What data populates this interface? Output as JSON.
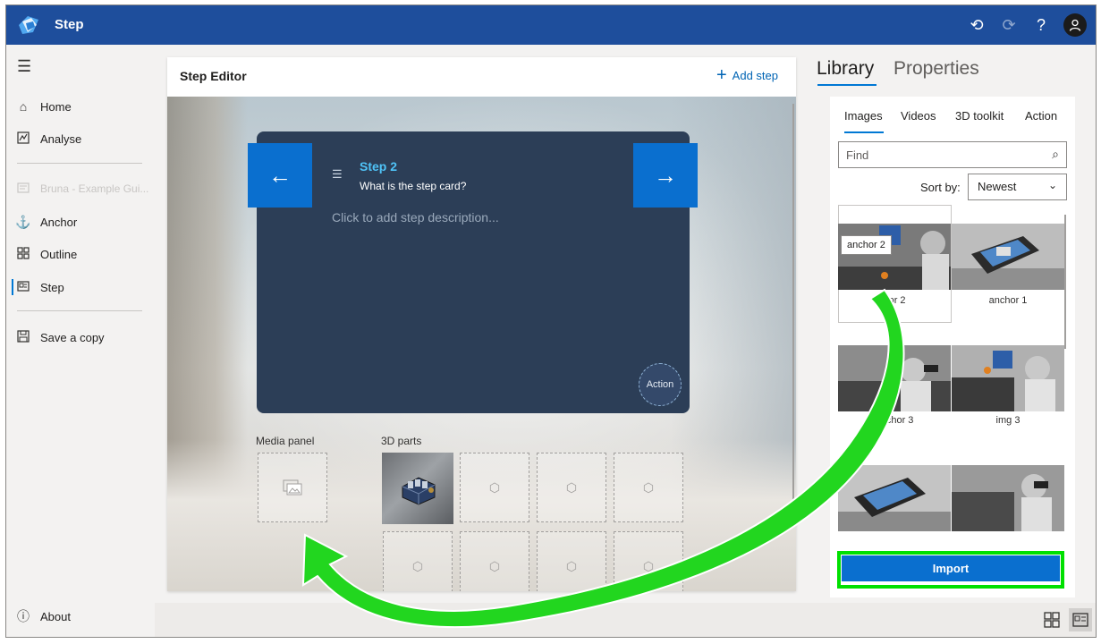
{
  "app": {
    "title": "Step"
  },
  "titlebar": {
    "icons": [
      "undo-icon",
      "redo-icon",
      "help-icon",
      "account-icon"
    ],
    "help_label": "?"
  },
  "nav": {
    "home": "Home",
    "analyse": "Analyse",
    "guide": "Bruna - Example Gui...",
    "anchor": "Anchor",
    "outline": "Outline",
    "step": "Step",
    "save_copy": "Save a copy",
    "about": "About"
  },
  "editor": {
    "title": "Step Editor",
    "add_step": "Add step",
    "card": {
      "step_number": "Step 2",
      "question": "What is the step card?",
      "description_placeholder": "Click to add step description...",
      "action": "Action"
    },
    "media_panel_label": "Media panel",
    "parts_label": "3D parts"
  },
  "right_panel": {
    "tabs": [
      "Library",
      "Properties"
    ],
    "active_tab": "Library",
    "library_tabs": [
      "Images",
      "Videos",
      "3D toolkit",
      "Action"
    ],
    "active_library_tab": "Images",
    "find_placeholder": "Find",
    "sort_label": "Sort by:",
    "sort_value": "Newest",
    "images": [
      {
        "label": "anchor 2",
        "tooltip": "anchor 2",
        "display_label": "hor 2"
      },
      {
        "label": "anchor 1"
      },
      {
        "label": "anchor 3"
      },
      {
        "label": "img 3"
      },
      {
        "label": ""
      },
      {
        "label": ""
      }
    ],
    "import_label": "Import"
  },
  "colors": {
    "accent": "#0a6fcf",
    "titlebar": "#1e4e9c",
    "highlight": "#00e000",
    "card": "#2c3e57",
    "step_number": "#4fc3f7"
  }
}
